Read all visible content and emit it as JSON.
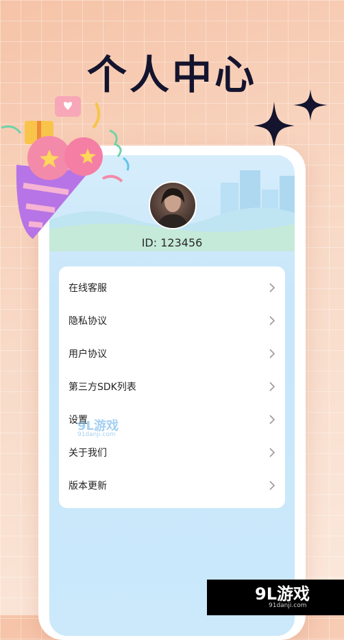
{
  "headline": "个人中心",
  "profile": {
    "user_id": "ID: 123456"
  },
  "menu": [
    {
      "label": "在线客服"
    },
    {
      "label": "隐私协议"
    },
    {
      "label": "用户协议"
    },
    {
      "label": "第三方SDK列表"
    },
    {
      "label": "设置"
    },
    {
      "label": "关于我们"
    },
    {
      "label": "版本更新"
    }
  ],
  "watermark": {
    "text": "9L游戏",
    "url": "91danji.com"
  },
  "brand": {
    "logo": "9L游戏",
    "url": "91danji.com"
  },
  "colors": {
    "background": "#f8d9c6",
    "headline": "#14142e",
    "screen": "#cbe9fb",
    "card": "#ffffff",
    "chevron": "#9a9a9a"
  }
}
